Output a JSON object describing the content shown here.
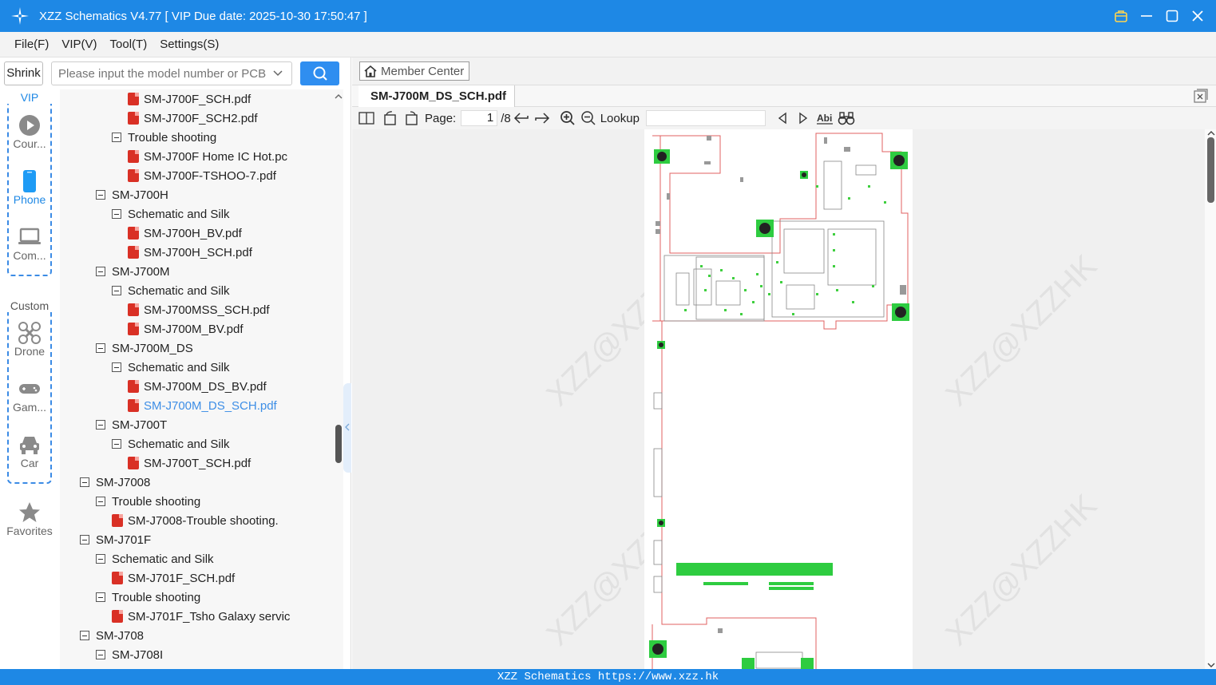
{
  "window": {
    "title": "XZZ Schematics V4.77 [ VIP Due date: 2025-10-30 17:50:47 ]"
  },
  "menu": [
    "File(F)",
    "VIP(V)",
    "Tool(T)",
    "Settings(S)"
  ],
  "search": {
    "shrink_label": "Shrink",
    "placeholder": "Please input the model number or PCB"
  },
  "sidebar": {
    "vip_label": "VIP",
    "custom_label": "Custom",
    "items": [
      {
        "label": "Cour...",
        "icon": "play-circle-icon"
      },
      {
        "label": "Phone",
        "icon": "phone-icon"
      },
      {
        "label": "Com...",
        "icon": "laptop-icon"
      },
      {
        "label": "Drone",
        "icon": "drone-icon"
      },
      {
        "label": "Gam...",
        "icon": "gamepad-icon"
      },
      {
        "label": "Car",
        "icon": "car-icon"
      },
      {
        "label": "Favorites",
        "icon": "star-icon"
      }
    ]
  },
  "tree": [
    {
      "label": "SM-J700F_SCH.pdf",
      "type": "file",
      "level": 3
    },
    {
      "label": "SM-J700F_SCH2.pdf",
      "type": "file",
      "level": 3
    },
    {
      "label": "Trouble shooting",
      "type": "folder",
      "level": 2
    },
    {
      "label": "SM-J700F Home IC Hot.pc",
      "type": "file",
      "level": 3
    },
    {
      "label": "SM-J700F-TSHOO-7.pdf",
      "type": "file",
      "level": 3
    },
    {
      "label": "SM-J700H",
      "type": "folder",
      "level": 1
    },
    {
      "label": "Schematic and Silk",
      "type": "folder",
      "level": 2
    },
    {
      "label": "SM-J700H_BV.pdf",
      "type": "file",
      "level": 3
    },
    {
      "label": "SM-J700H_SCH.pdf",
      "type": "file",
      "level": 3
    },
    {
      "label": "SM-J700M",
      "type": "folder",
      "level": 1
    },
    {
      "label": "Schematic and Silk",
      "type": "folder",
      "level": 2
    },
    {
      "label": "SM-J700MSS_SCH.pdf",
      "type": "file",
      "level": 3
    },
    {
      "label": "SM-J700M_BV.pdf",
      "type": "file",
      "level": 3
    },
    {
      "label": "SM-J700M_DS",
      "type": "folder",
      "level": 1
    },
    {
      "label": "Schematic and Silk",
      "type": "folder",
      "level": 2
    },
    {
      "label": "SM-J700M_DS_BV.pdf",
      "type": "file",
      "level": 3
    },
    {
      "label": "SM-J700M_DS_SCH.pdf",
      "type": "file",
      "level": 3,
      "selected": true
    },
    {
      "label": "SM-J700T",
      "type": "folder",
      "level": 1
    },
    {
      "label": "Schematic and Silk",
      "type": "folder",
      "level": 2
    },
    {
      "label": "SM-J700T_SCH.pdf",
      "type": "file",
      "level": 3
    },
    {
      "label": "SM-J7008",
      "type": "folder",
      "level": 0
    },
    {
      "label": "Trouble shooting",
      "type": "folder",
      "level": 1
    },
    {
      "label": "SM-J7008-Trouble shooting.",
      "type": "file",
      "level": 2
    },
    {
      "label": "SM-J701F",
      "type": "folder",
      "level": 0
    },
    {
      "label": "Schematic and Silk",
      "type": "folder",
      "level": 1
    },
    {
      "label": "SM-J701F_SCH.pdf",
      "type": "file",
      "level": 2
    },
    {
      "label": "Trouble shooting",
      "type": "folder",
      "level": 1
    },
    {
      "label": "SM-J701F_Tsho Galaxy servic",
      "type": "file",
      "level": 2
    },
    {
      "label": "SM-J708",
      "type": "folder",
      "level": 0
    },
    {
      "label": "SM-J708I",
      "type": "folder",
      "level": 1
    }
  ],
  "viewer": {
    "member_center": "Member Center",
    "tab_title": "SM-J700M_DS_SCH.pdf",
    "page_label": "Page:",
    "page_current": "1",
    "page_total": "/8",
    "lookup_label": "Lookup",
    "watermark": "XZZ@XZZHK"
  },
  "status": "XZZ Schematics https://www.xzz.hk"
}
